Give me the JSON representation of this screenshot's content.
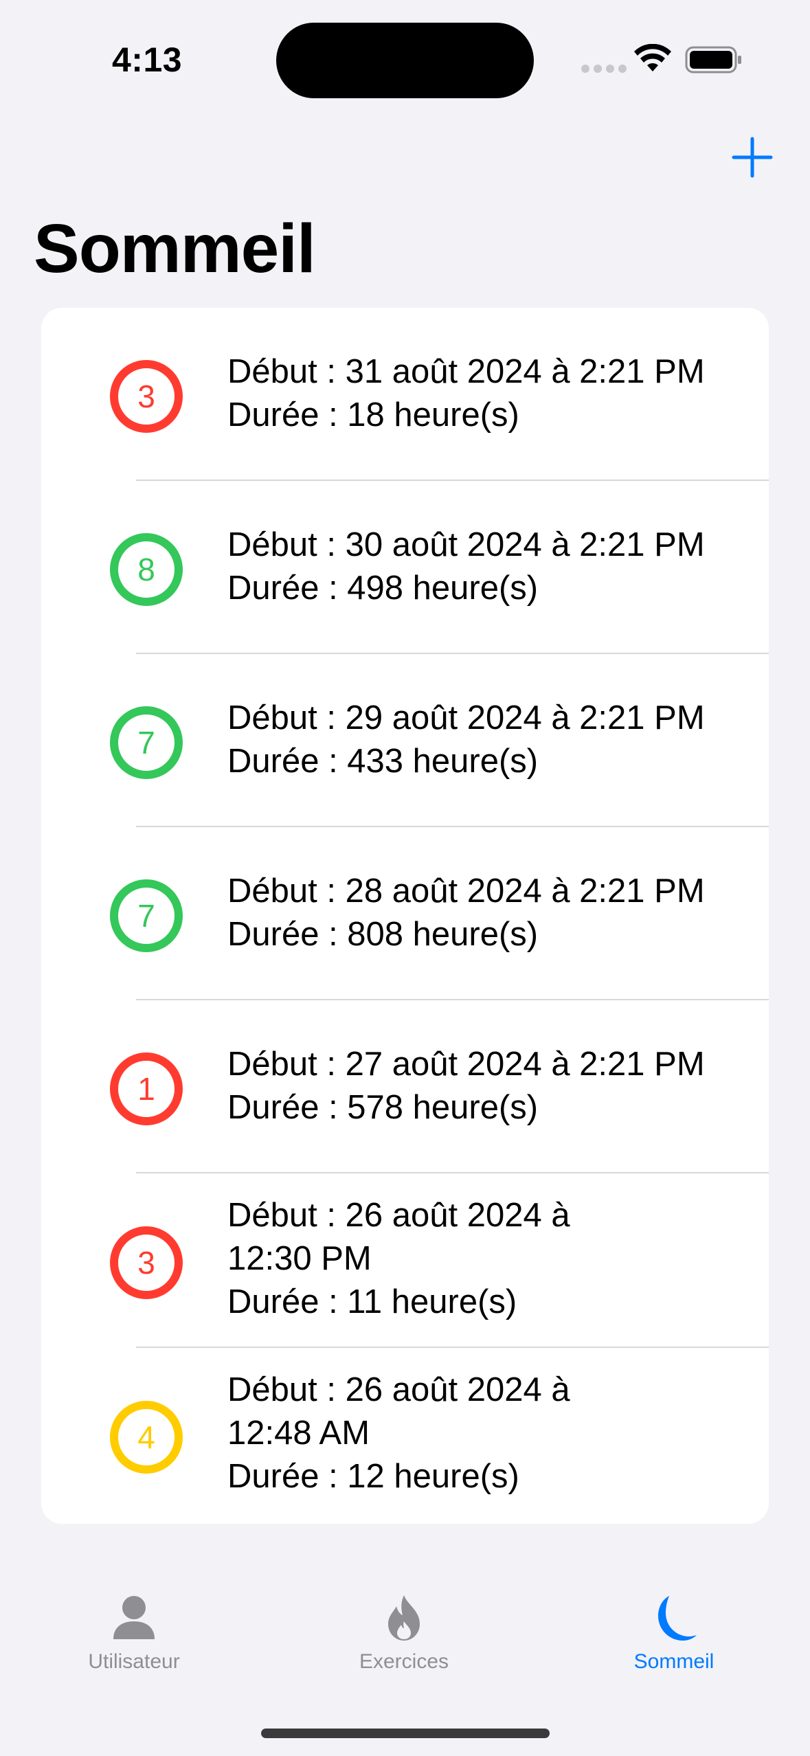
{
  "status_bar": {
    "time": "4:13"
  },
  "nav": {
    "title": "Sommeil",
    "add_icon": "plus-icon"
  },
  "sleep_entries": [
    {
      "score": "3",
      "color": "red",
      "line1": "Début : 31 août 2024 à 2:21 PM",
      "line2": "",
      "duration": "Durée : 18 heure(s)"
    },
    {
      "score": "8",
      "color": "green",
      "line1": "Début : 30 août 2024 à 2:21 PM",
      "line2": "",
      "duration": "Durée : 498 heure(s)"
    },
    {
      "score": "7",
      "color": "green",
      "line1": "Début : 29 août 2024 à 2:21 PM",
      "line2": "",
      "duration": "Durée : 433 heure(s)"
    },
    {
      "score": "7",
      "color": "green",
      "line1": "Début : 28 août 2024 à 2:21 PM",
      "line2": "",
      "duration": "Durée : 808 heure(s)"
    },
    {
      "score": "1",
      "color": "red",
      "line1": "Début : 27 août 2024 à 2:21 PM",
      "line2": "",
      "duration": "Durée : 578 heure(s)"
    },
    {
      "score": "3",
      "color": "red",
      "line1": "Début : 26 août 2024 à",
      "line2": "12:30 PM",
      "duration": "Durée : 11 heure(s)"
    },
    {
      "score": "4",
      "color": "yellow",
      "line1": "Début : 26 août 2024 à",
      "line2": "12:48 AM",
      "duration": "Durée : 12 heure(s)"
    }
  ],
  "tab_bar": {
    "tabs": [
      {
        "label": "Utilisateur",
        "icon": "person-icon",
        "active": false
      },
      {
        "label": "Exercices",
        "icon": "flame-icon",
        "active": false
      },
      {
        "label": "Sommeil",
        "icon": "moon-icon",
        "active": true
      }
    ]
  },
  "colors": {
    "accent": "#007aff",
    "red": "#ff3b30",
    "green": "#34c759",
    "yellow": "#ffcc00",
    "inactive": "#8e8e93"
  }
}
